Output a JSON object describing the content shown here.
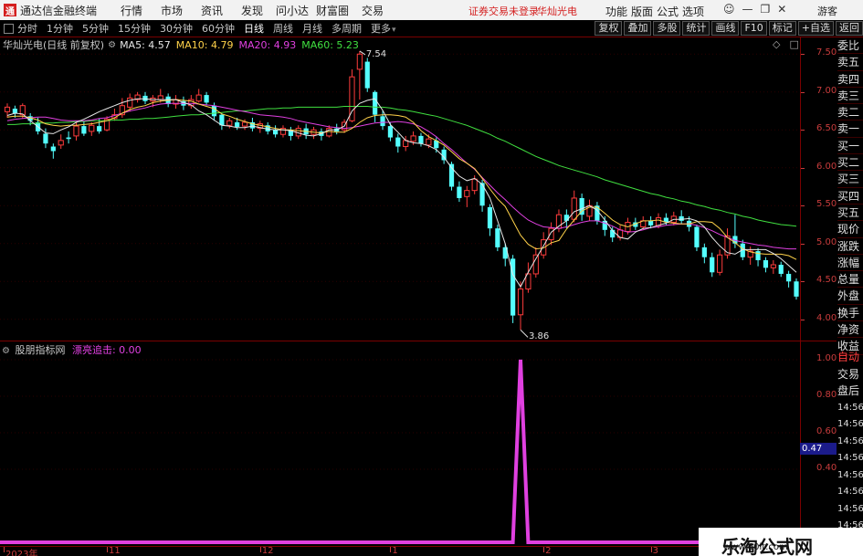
{
  "app": {
    "logo": "通",
    "title": "通达信金融终端"
  },
  "menu": [
    "行情",
    "市场",
    "资讯",
    "发现",
    "问小达",
    "财富圈",
    "交易"
  ],
  "status": {
    "trade": "证券交易未登录",
    "stock": "华灿光电"
  },
  "right_menu": [
    "功能",
    "版面",
    "公式",
    "选项"
  ],
  "window_icons": [
    "user-icon",
    "minimize-icon",
    "restore-icon",
    "close-icon"
  ],
  "guest": "游客",
  "periods": [
    {
      "label": "分时"
    },
    {
      "label": "1分钟"
    },
    {
      "label": "5分钟"
    },
    {
      "label": "15分钟"
    },
    {
      "label": "30分钟"
    },
    {
      "label": "60分钟"
    },
    {
      "label": "日线",
      "active": true
    },
    {
      "label": "周线"
    },
    {
      "label": "月线"
    },
    {
      "label": "多周期"
    },
    {
      "label": "更多"
    }
  ],
  "toolbar_buttons": [
    "复权",
    "叠加",
    "多股",
    "统计",
    "画线",
    "F10",
    "标记",
    "+自选",
    "返回"
  ],
  "chart": {
    "stock_label": "华灿光电(日线 前复权)",
    "ma5": "MA5: 4.57",
    "ma10": "MA10: 4.79",
    "ma20": "MA20: 4.93",
    "ma60": "MA60: 5.23",
    "high_label": "7.54",
    "low_label": "3.86",
    "y_ticks": [
      "7.50",
      "7.00",
      "6.50",
      "6.00",
      "5.50",
      "5.00",
      "4.50",
      "4.00"
    ],
    "colors": {
      "up": "#ff3c3c",
      "down": "#54ffff",
      "ma5": "#e6e6e6",
      "ma10": "#ffd24a",
      "ma20": "#e040e0",
      "ma60": "#40e040"
    },
    "ma5_values": [
      6.69,
      6.72,
      6.71,
      6.62,
      6.54,
      6.46,
      6.45,
      6.5,
      6.54,
      6.6,
      6.64,
      6.69,
      6.74,
      6.78,
      6.82,
      6.86,
      6.89,
      6.91,
      6.91,
      6.9,
      6.9,
      6.9,
      6.9,
      6.86,
      6.83,
      6.75,
      6.7,
      6.63,
      6.56,
      6.55,
      6.53,
      6.53,
      6.55,
      6.53,
      6.51,
      6.5,
      6.5,
      6.49,
      6.46,
      6.43,
      6.42,
      6.45,
      6.5,
      6.5,
      6.55,
      6.75,
      6.85,
      6.89,
      6.91,
      6.76,
      6.57,
      6.47,
      6.36,
      6.33,
      6.32,
      6.29,
      6.24,
      6.14,
      6.0,
      5.89,
      5.83,
      5.86,
      5.78,
      5.6,
      5.3,
      5.0,
      4.59,
      4.43,
      4.62,
      4.8,
      4.97,
      5.15,
      5.23,
      5.3,
      5.42,
      5.46,
      5.5,
      5.44,
      5.31,
      5.17,
      5.08,
      5.06,
      5.15,
      5.2,
      5.21,
      5.24,
      5.27,
      5.32,
      5.32,
      5.33,
      5.3,
      5.22,
      5.08,
      4.97,
      4.88,
      4.86,
      4.92,
      4.92,
      4.92,
      4.92,
      4.87,
      4.8,
      4.71,
      4.62
    ],
    "ma10_values": [
      6.67,
      6.68,
      6.68,
      6.66,
      6.63,
      6.58,
      6.56,
      6.55,
      6.56,
      6.56,
      6.57,
      6.58,
      6.6,
      6.62,
      6.66,
      6.72,
      6.77,
      6.8,
      6.82,
      6.86,
      6.88,
      6.89,
      6.9,
      6.89,
      6.88,
      6.84,
      6.81,
      6.78,
      6.71,
      6.68,
      6.64,
      6.61,
      6.58,
      6.56,
      6.54,
      6.52,
      6.5,
      6.5,
      6.49,
      6.48,
      6.47,
      6.46,
      6.48,
      6.47,
      6.47,
      6.52,
      6.6,
      6.66,
      6.69,
      6.7,
      6.7,
      6.69,
      6.67,
      6.6,
      6.49,
      6.41,
      6.36,
      6.3,
      6.21,
      6.12,
      6.06,
      5.99,
      5.86,
      5.72,
      5.59,
      5.49,
      5.3,
      5.11,
      4.99,
      4.93,
      4.94,
      5.01,
      5.04,
      5.19,
      5.31,
      5.43,
      5.48,
      5.48,
      5.4,
      5.31,
      5.25,
      5.22,
      5.26,
      5.3,
      5.3,
      5.31,
      5.28,
      5.27,
      5.26,
      5.26,
      5.29,
      5.29,
      5.28,
      5.2,
      5.08,
      5.01,
      4.93,
      4.89,
      4.87,
      4.86,
      4.86,
      4.86,
      4.84,
      4.79
    ],
    "ma20_values": [
      6.62,
      6.64,
      6.65,
      6.66,
      6.67,
      6.67,
      6.65,
      6.63,
      6.62,
      6.62,
      6.62,
      6.63,
      6.65,
      6.66,
      6.69,
      6.72,
      6.75,
      6.77,
      6.79,
      6.82,
      6.84,
      6.85,
      6.85,
      6.85,
      6.85,
      6.84,
      6.83,
      6.82,
      6.8,
      6.78,
      6.76,
      6.74,
      6.72,
      6.7,
      6.69,
      6.68,
      6.67,
      6.65,
      6.62,
      6.6,
      6.58,
      6.56,
      6.54,
      6.53,
      6.52,
      6.53,
      6.55,
      6.57,
      6.59,
      6.6,
      6.6,
      6.61,
      6.6,
      6.58,
      6.54,
      6.48,
      6.41,
      6.32,
      6.24,
      6.15,
      6.06,
      5.98,
      5.87,
      5.77,
      5.67,
      5.58,
      5.48,
      5.39,
      5.31,
      5.26,
      5.22,
      5.21,
      5.2,
      5.22,
      5.25,
      5.28,
      5.3,
      5.3,
      5.27,
      5.23,
      5.18,
      5.15,
      5.16,
      5.18,
      5.21,
      5.22,
      5.24,
      5.25,
      5.26,
      5.26,
      5.24,
      5.21,
      5.17,
      5.12,
      5.08,
      5.04,
      5.02,
      5.0,
      4.98,
      4.97,
      4.95,
      4.94,
      4.93,
      4.93
    ],
    "ma60_values": [
      6.57,
      6.57,
      6.58,
      6.58,
      6.59,
      6.59,
      6.59,
      6.6,
      6.6,
      6.61,
      6.61,
      6.62,
      6.62,
      6.62,
      6.63,
      6.63,
      6.64,
      6.64,
      6.65,
      6.65,
      6.66,
      6.67,
      6.68,
      6.69,
      6.7,
      6.7,
      6.71,
      6.72,
      6.73,
      6.74,
      6.75,
      6.75,
      6.76,
      6.77,
      6.78,
      6.78,
      6.79,
      6.79,
      6.8,
      6.8,
      6.8,
      6.8,
      6.8,
      6.8,
      6.81,
      6.81,
      6.81,
      6.81,
      6.8,
      6.8,
      6.79,
      6.77,
      6.76,
      6.74,
      6.72,
      6.7,
      6.68,
      6.65,
      6.62,
      6.59,
      6.56,
      6.52,
      6.48,
      6.44,
      6.39,
      6.35,
      6.3,
      6.25,
      6.2,
      6.15,
      6.11,
      6.07,
      6.03,
      6.0,
      5.97,
      5.94,
      5.91,
      5.88,
      5.84,
      5.81,
      5.78,
      5.75,
      5.72,
      5.69,
      5.66,
      5.64,
      5.61,
      5.59,
      5.56,
      5.54,
      5.51,
      5.49,
      5.46,
      5.44,
      5.41,
      5.39,
      5.36,
      5.34,
      5.31,
      5.29,
      5.27,
      5.25,
      5.24,
      5.23
    ],
    "candles": [
      [
        6.74,
        6.8,
        6.85,
        6.66
      ],
      [
        6.78,
        6.72,
        6.82,
        6.66
      ],
      [
        6.7,
        6.82,
        6.85,
        6.65
      ],
      [
        6.68,
        6.62,
        6.72,
        6.56
      ],
      [
        6.6,
        6.48,
        6.66,
        6.44
      ],
      [
        6.45,
        6.32,
        6.52,
        6.26
      ],
      [
        6.28,
        6.22,
        6.32,
        6.12
      ],
      [
        6.3,
        6.36,
        6.44,
        6.25
      ],
      [
        6.4,
        6.38,
        6.48,
        6.32
      ],
      [
        6.42,
        6.55,
        6.6,
        6.36
      ],
      [
        6.55,
        6.45,
        6.62,
        6.42
      ],
      [
        6.48,
        6.56,
        6.6,
        6.42
      ],
      [
        6.55,
        6.48,
        6.65,
        6.45
      ],
      [
        6.5,
        6.64,
        6.68,
        6.48
      ],
      [
        6.65,
        6.7,
        6.78,
        6.62
      ],
      [
        6.7,
        6.82,
        6.92,
        6.66
      ],
      [
        6.8,
        6.92,
        6.98,
        6.74
      ],
      [
        6.9,
        6.96,
        7.0,
        6.86
      ],
      [
        6.95,
        6.88,
        7.0,
        6.84
      ],
      [
        6.88,
        6.92,
        6.96,
        6.8
      ],
      [
        6.9,
        6.95,
        7.04,
        6.86
      ],
      [
        6.94,
        6.84,
        6.98,
        6.8
      ],
      [
        6.84,
        6.9,
        6.96,
        6.78
      ],
      [
        6.88,
        6.82,
        6.94,
        6.76
      ],
      [
        6.82,
        6.9,
        6.96,
        6.78
      ],
      [
        6.88,
        6.96,
        7.04,
        6.86
      ],
      [
        6.96,
        6.86,
        7.0,
        6.82
      ],
      [
        6.82,
        6.68,
        6.86,
        6.62
      ],
      [
        6.7,
        6.56,
        6.72,
        6.5
      ],
      [
        6.56,
        6.62,
        6.66,
        6.52
      ],
      [
        6.6,
        6.54,
        6.66,
        6.5
      ],
      [
        6.55,
        6.6,
        6.64,
        6.5
      ],
      [
        6.6,
        6.52,
        6.66,
        6.48
      ],
      [
        6.52,
        6.58,
        6.62,
        6.46
      ],
      [
        6.56,
        6.48,
        6.6,
        6.44
      ],
      [
        6.5,
        6.44,
        6.56,
        6.4
      ],
      [
        6.44,
        6.52,
        6.56,
        6.4
      ],
      [
        6.5,
        6.42,
        6.54,
        6.36
      ],
      [
        6.42,
        6.52,
        6.56,
        6.38
      ],
      [
        6.52,
        6.44,
        6.58,
        6.38
      ],
      [
        6.44,
        6.5,
        6.54,
        6.38
      ],
      [
        6.48,
        6.42,
        6.52,
        6.36
      ],
      [
        6.42,
        6.52,
        6.56,
        6.4
      ],
      [
        6.52,
        6.48,
        6.58,
        6.44
      ],
      [
        6.5,
        6.6,
        6.64,
        6.46
      ],
      [
        6.62,
        7.2,
        7.3,
        6.6
      ],
      [
        7.3,
        7.5,
        7.54,
        6.9
      ],
      [
        7.4,
        7.05,
        7.45,
        7.0
      ],
      [
        7.0,
        6.7,
        7.02,
        6.6
      ],
      [
        6.68,
        6.55,
        6.75,
        6.5
      ],
      [
        6.55,
        6.4,
        6.6,
        6.35
      ],
      [
        6.4,
        6.28,
        6.45,
        6.2
      ],
      [
        6.28,
        6.36,
        6.42,
        6.22
      ],
      [
        6.35,
        6.42,
        6.48,
        6.3
      ],
      [
        6.42,
        6.32,
        6.46,
        6.28
      ],
      [
        6.3,
        6.38,
        6.44,
        6.26
      ],
      [
        6.36,
        6.26,
        6.4,
        6.2
      ],
      [
        6.24,
        6.1,
        6.28,
        6.05
      ],
      [
        6.05,
        5.75,
        6.08,
        5.7
      ],
      [
        5.75,
        5.6,
        5.82,
        5.55
      ],
      [
        5.62,
        5.7,
        5.76,
        5.48
      ],
      [
        5.7,
        5.85,
        5.9,
        5.65
      ],
      [
        5.8,
        5.5,
        5.84,
        5.42
      ],
      [
        5.48,
        5.2,
        5.52,
        5.1
      ],
      [
        5.2,
        4.95,
        5.25,
        4.9
      ],
      [
        4.95,
        4.8,
        5.0,
        4.7
      ],
      [
        4.8,
        4.05,
        4.85,
        3.95
      ],
      [
        4.06,
        4.4,
        4.5,
        3.86
      ],
      [
        4.4,
        4.6,
        4.75,
        4.35
      ],
      [
        4.6,
        4.85,
        4.95,
        4.55
      ],
      [
        4.85,
        5.05,
        5.15,
        4.8
      ],
      [
        5.05,
        5.2,
        5.28,
        4.98
      ],
      [
        5.2,
        5.38,
        5.45,
        5.15
      ],
      [
        5.38,
        5.3,
        5.45,
        5.2
      ],
      [
        5.32,
        5.6,
        5.7,
        5.28
      ],
      [
        5.6,
        5.38,
        5.66,
        5.3
      ],
      [
        5.36,
        5.5,
        5.58,
        5.3
      ],
      [
        5.5,
        5.3,
        5.55,
        5.25
      ],
      [
        5.3,
        5.18,
        5.36,
        5.1
      ],
      [
        5.18,
        5.08,
        5.22,
        5.02
      ],
      [
        5.08,
        5.18,
        5.24,
        5.04
      ],
      [
        5.16,
        5.28,
        5.34,
        5.12
      ],
      [
        5.28,
        5.22,
        5.34,
        5.18
      ],
      [
        5.22,
        5.3,
        5.36,
        5.18
      ],
      [
        5.3,
        5.24,
        5.36,
        5.2
      ],
      [
        5.24,
        5.34,
        5.4,
        5.2
      ],
      [
        5.34,
        5.28,
        5.4,
        5.24
      ],
      [
        5.28,
        5.36,
        5.42,
        5.24
      ],
      [
        5.36,
        5.3,
        5.44,
        5.26
      ],
      [
        5.3,
        5.22,
        5.36,
        5.16
      ],
      [
        5.22,
        4.95,
        5.25,
        4.9
      ],
      [
        4.95,
        4.82,
        5.0,
        4.74
      ],
      [
        4.82,
        4.62,
        4.88,
        4.56
      ],
      [
        4.62,
        4.85,
        4.92,
        4.58
      ],
      [
        4.85,
        5.1,
        5.2,
        4.8
      ],
      [
        5.1,
        5.0,
        5.38,
        4.94
      ],
      [
        5.0,
        4.82,
        5.05,
        4.78
      ],
      [
        4.82,
        4.9,
        4.96,
        4.72
      ],
      [
        4.9,
        4.78,
        4.94,
        4.7
      ],
      [
        4.78,
        4.68,
        4.82,
        4.62
      ],
      [
        4.68,
        4.72,
        4.78,
        4.6
      ],
      [
        4.72,
        4.6,
        4.76,
        4.56
      ],
      [
        4.6,
        4.5,
        4.64,
        4.42
      ],
      [
        4.5,
        4.3,
        4.54,
        4.26
      ]
    ]
  },
  "sidebar": [
    "委比",
    "卖五",
    "卖四",
    "卖三",
    "卖二",
    "卖一",
    "买一",
    "买二",
    "买三",
    "买四",
    "买五",
    "现价",
    "涨跌",
    "涨幅",
    "总量",
    "外盘",
    "换手",
    "净资",
    "收益"
  ],
  "indicator": {
    "name": "股朋指标网",
    "label": "漂亮追击: 0.00",
    "y_ticks": [
      "1.00",
      "0.80",
      "0.60",
      "0.40"
    ],
    "current_value": "0.47",
    "color": "#e040e0",
    "values": [
      0,
      0,
      0,
      0,
      0,
      0,
      0,
      0,
      0,
      0,
      0,
      0,
      0,
      0,
      0,
      0,
      0,
      0,
      0,
      0,
      0,
      0,
      0,
      0,
      0,
      0,
      0,
      0,
      0,
      0,
      0,
      0,
      0,
      0,
      0,
      0,
      0,
      0,
      0,
      0,
      0,
      0,
      0,
      0,
      0,
      0,
      0,
      0,
      0,
      0,
      0,
      0,
      0,
      0,
      0,
      0,
      0,
      0,
      0,
      0,
      0,
      0,
      0,
      0,
      0,
      0,
      0,
      1,
      0,
      0,
      0,
      0,
      0,
      0,
      0,
      0,
      0,
      0,
      0,
      0,
      0,
      0,
      0,
      0,
      0,
      0,
      0,
      0,
      0,
      0,
      0,
      0,
      0,
      0,
      0,
      0,
      0,
      0,
      0,
      0,
      0,
      0,
      0,
      0
    ]
  },
  "sidebar2": [
    {
      "label": "自动",
      "color": "#ff4040"
    },
    {
      "label": "交易"
    },
    {
      "label": "盘后"
    },
    {
      "label": "14:56",
      "time": true
    },
    {
      "label": "14:56",
      "time": true
    },
    {
      "label": "14:56",
      "time": true
    },
    {
      "label": "14:56",
      "time": true
    },
    {
      "label": "14:56",
      "time": true
    },
    {
      "label": "14:56",
      "time": true
    },
    {
      "label": "14:56",
      "time": true
    },
    {
      "label": "14:56",
      "time": true
    }
  ],
  "x_ticks": [
    {
      "label": "2023年",
      "i": 0
    },
    {
      "label": "11",
      "i": 13
    },
    {
      "label": "12",
      "i": 33
    },
    {
      "label": "1",
      "i": 50
    },
    {
      "label": "2",
      "i": 70
    },
    {
      "label": "3",
      "i": 84
    }
  ],
  "watermark": {
    "main": "乐淘公式网",
    "url": "www.60lt.com"
  }
}
